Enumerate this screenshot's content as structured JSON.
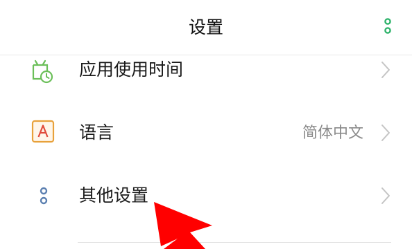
{
  "header": {
    "title": "设置",
    "menu_icon": "more-vertical-icon"
  },
  "items": [
    {
      "label": "应用使用时间",
      "value": "",
      "icon": "screen-time-icon",
      "icon_color": "#6bbf59"
    },
    {
      "label": "语言",
      "value": "简体中文",
      "icon": "language-icon",
      "icon_color": "#e8a13a"
    },
    {
      "label": "其他设置",
      "value": "",
      "icon": "other-settings-icon",
      "icon_color": "#5b7fb0"
    }
  ],
  "colors": {
    "accent_green": "#2fb36b",
    "annotation_red": "#ff0000"
  }
}
